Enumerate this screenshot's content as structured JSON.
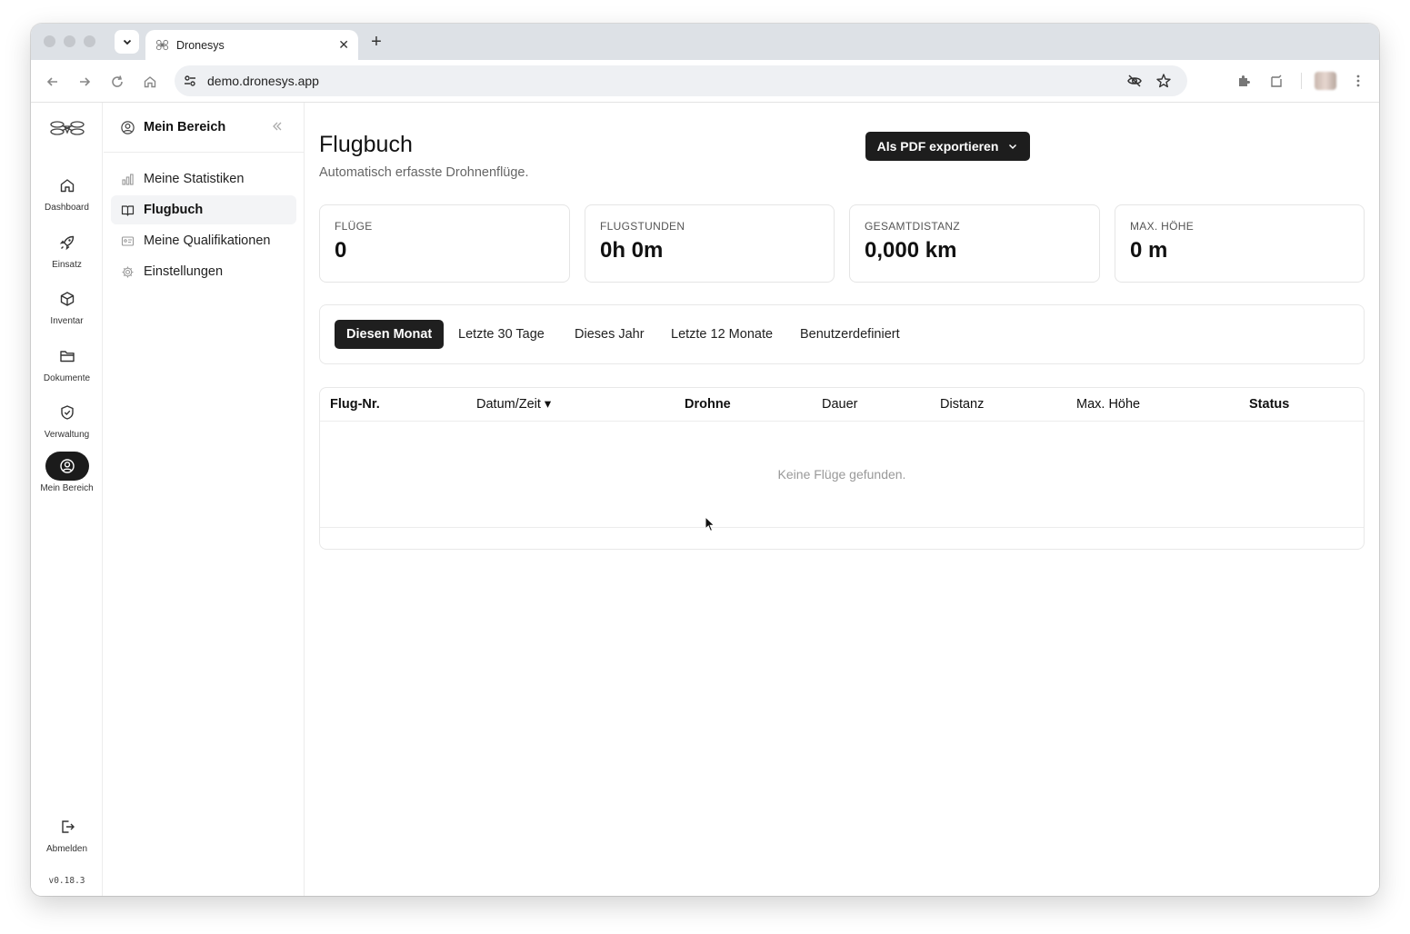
{
  "browser": {
    "tab_title": "Dronesys",
    "url": "demo.dronesys.app"
  },
  "rail": {
    "items": [
      {
        "label": "Dashboard",
        "icon": "home-icon"
      },
      {
        "label": "Einsatz",
        "icon": "rocket-icon"
      },
      {
        "label": "Inventar",
        "icon": "box-icon"
      },
      {
        "label": "Dokumente",
        "icon": "folder-icon"
      },
      {
        "label": "Verwaltung",
        "icon": "shield-check-icon"
      },
      {
        "label": "Mein Bereich",
        "icon": "user-circle-icon"
      }
    ],
    "logout_label": "Abmelden",
    "version": "v0.18.3"
  },
  "subnav": {
    "title": "Mein Bereich",
    "items": [
      {
        "label": "Meine Statistiken",
        "icon": "bar-chart-icon"
      },
      {
        "label": "Flugbuch",
        "icon": "book-open-icon"
      },
      {
        "label": "Meine Qualifikationen",
        "icon": "id-card-icon"
      },
      {
        "label": "Einstellungen",
        "icon": "gear-icon"
      }
    ]
  },
  "main": {
    "title": "Flugbuch",
    "subtitle": "Automatisch erfasste Drohnenflüge.",
    "export_label": "Als PDF exportieren",
    "stats": [
      {
        "label": "FLÜGE",
        "value": "0"
      },
      {
        "label": "FLUGSTUNDEN",
        "value": "0h 0m"
      },
      {
        "label": "GESAMTDISTANZ",
        "value": "0,000 km"
      },
      {
        "label": "MAX. HÖHE",
        "value": "0 m"
      }
    ],
    "filters": [
      "Diesen Monat",
      "Letzte 30 Tage",
      "Dieses Jahr",
      "Letzte 12 Monate",
      "Benutzerdefiniert"
    ],
    "table": {
      "columns": [
        "Flug-Nr.",
        "Datum/Zeit ▾",
        "Drohne",
        "Dauer",
        "Distanz",
        "Max. Höhe",
        "Status"
      ],
      "empty_message": "Keine Flüge gefunden."
    }
  },
  "colors": {
    "accent_dark": "#1d1d1d",
    "muted_text": "#666666",
    "border": "#e5e5e5"
  }
}
